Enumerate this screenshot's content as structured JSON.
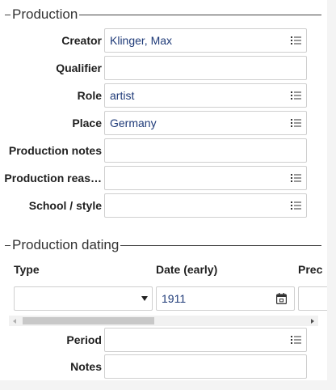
{
  "production": {
    "section_title": "Production",
    "fields": [
      {
        "label": "Creator",
        "value": "Klinger, Max",
        "has_list_icon": true
      },
      {
        "label": "Qualifier",
        "value": "",
        "has_list_icon": false
      },
      {
        "label": "Role",
        "value": "artist",
        "has_list_icon": true
      },
      {
        "label": "Place",
        "value": "Germany",
        "has_list_icon": true
      },
      {
        "label": "Production notes",
        "value": "",
        "has_list_icon": false
      },
      {
        "label": "Production reas…",
        "value": "",
        "has_list_icon": true
      },
      {
        "label": "School / style",
        "value": "",
        "has_list_icon": true
      }
    ]
  },
  "production_dating": {
    "section_title": "Production dating",
    "columns": {
      "type": "Type",
      "date_early": "Date (early)",
      "precision": "Prec"
    },
    "row": {
      "type_value": "",
      "date_early_value": "1911"
    },
    "period": {
      "label": "Period",
      "value": ""
    },
    "notes": {
      "label": "Notes",
      "value": ""
    }
  },
  "icons": {
    "list": "list-icon",
    "calendar": "calendar-icon",
    "dropdown": "chevron-down-icon"
  },
  "colors": {
    "value_text": "#1e3a78",
    "border": "#cfcfcf",
    "label_text": "#1f1f1f"
  }
}
